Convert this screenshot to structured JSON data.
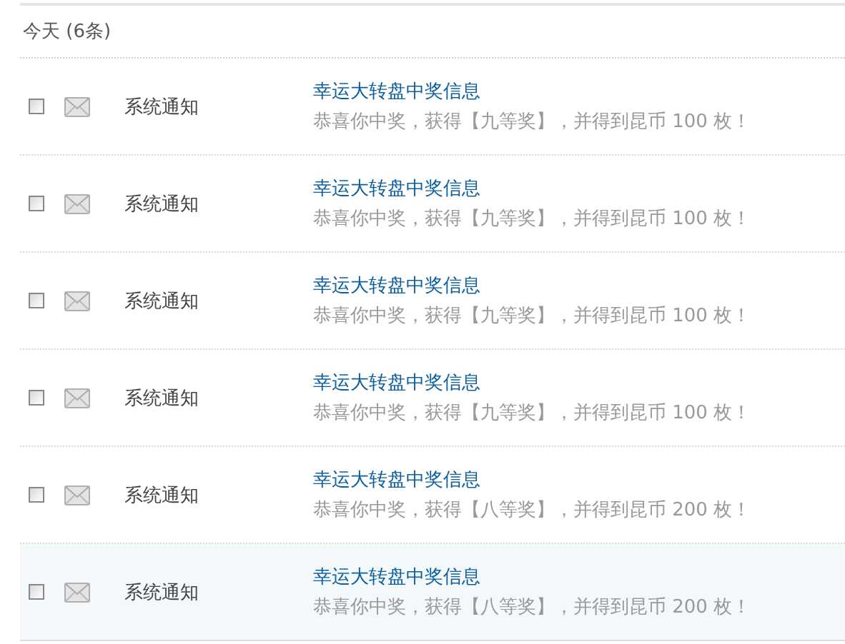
{
  "section": {
    "title": "今天 (6条)"
  },
  "messages": [
    {
      "checked": false,
      "highlighted": false,
      "sender": "系统通知",
      "title": "幸运大转盘中奖信息",
      "body": "恭喜你中奖，获得【九等奖】，并得到昆币 100 枚！"
    },
    {
      "checked": false,
      "highlighted": false,
      "sender": "系统通知",
      "title": "幸运大转盘中奖信息",
      "body": "恭喜你中奖，获得【九等奖】，并得到昆币 100 枚！"
    },
    {
      "checked": false,
      "highlighted": false,
      "sender": "系统通知",
      "title": "幸运大转盘中奖信息",
      "body": "恭喜你中奖，获得【九等奖】，并得到昆币 100 枚！"
    },
    {
      "checked": false,
      "highlighted": false,
      "sender": "系统通知",
      "title": "幸运大转盘中奖信息",
      "body": "恭喜你中奖，获得【九等奖】，并得到昆币 100 枚！"
    },
    {
      "checked": false,
      "highlighted": false,
      "sender": "系统通知",
      "title": "幸运大转盘中奖信息",
      "body": "恭喜你中奖，获得【八等奖】，并得到昆币 200 枚！"
    },
    {
      "checked": false,
      "highlighted": true,
      "sender": "系统通知",
      "title": "幸运大转盘中奖信息",
      "body": "恭喜你中奖，获得【八等奖】，并得到昆币 200 枚！"
    }
  ]
}
